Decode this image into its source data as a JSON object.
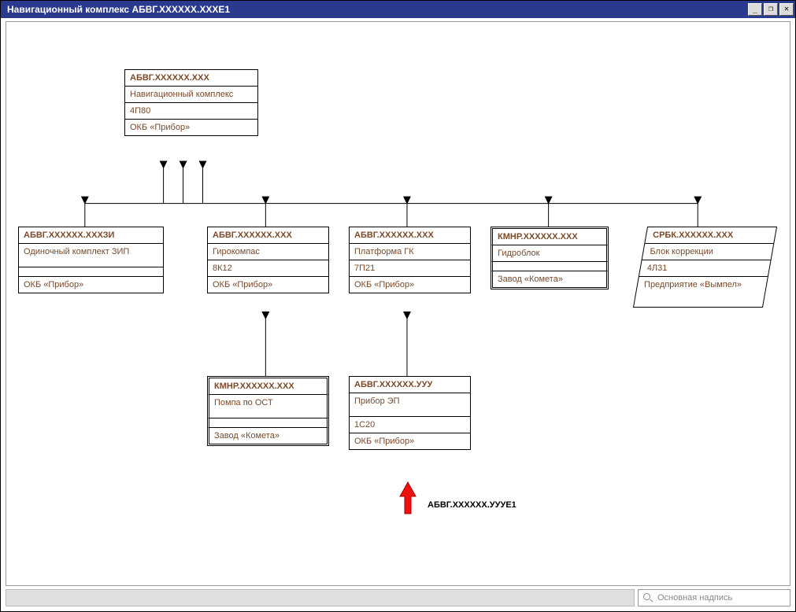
{
  "window": {
    "title": "Навигационный комплекс АБВГ.ХХХХХХ.ХХХЕ1",
    "buttons": {
      "min": "_",
      "max": "❐",
      "close": "✕"
    }
  },
  "statusbar": {
    "search_label": "Основная надпись"
  },
  "annotation": {
    "pointer_label": "АБВГ.ХХХХХХ.УУУЕ1"
  },
  "nodes": {
    "root": {
      "code": "АБВГ.ХХХХХХ.ХХХ",
      "desc": "Навигационный комплекс",
      "num": "4П80",
      "maker": "ОКБ «Прибор»"
    },
    "zip": {
      "code": "АБВГ.ХХХХХХ.ХХХЗИ",
      "desc": "Одиночный комплект ЗИП",
      "num": "",
      "maker": "ОКБ «Прибор»"
    },
    "gyro": {
      "code": "АБВГ.ХХХХХХ.ХХХ",
      "desc": "Гирокомпас",
      "num": "8К12",
      "maker": "ОКБ «Прибор»"
    },
    "platform": {
      "code": "АБВГ.ХХХХХХ.ХХХ",
      "desc": "Платформа ГК",
      "num": "7П21",
      "maker": "ОКБ «Прибор»"
    },
    "hydro": {
      "code": "КМНР.ХХХХХХ.ХХХ",
      "desc": "Гидроблок",
      "num": "",
      "maker": "Завод «Комета»"
    },
    "corr": {
      "code": "СРБК.ХХХХХХ.ХХХ",
      "desc": "Блок коррекции",
      "num": "4Л31",
      "maker": "Предприятие «Вымпел»"
    },
    "pump": {
      "code": "КМНР.ХХХХХХ.ХХХ",
      "desc": "Помпа по ОСТ",
      "num": "",
      "maker": "Завод «Комета»"
    },
    "device": {
      "code": "АБВГ.ХХХХХХ.УУУ",
      "desc": "Прибор ЭП",
      "num": "1С20",
      "maker": "ОКБ «Прибор»"
    }
  }
}
